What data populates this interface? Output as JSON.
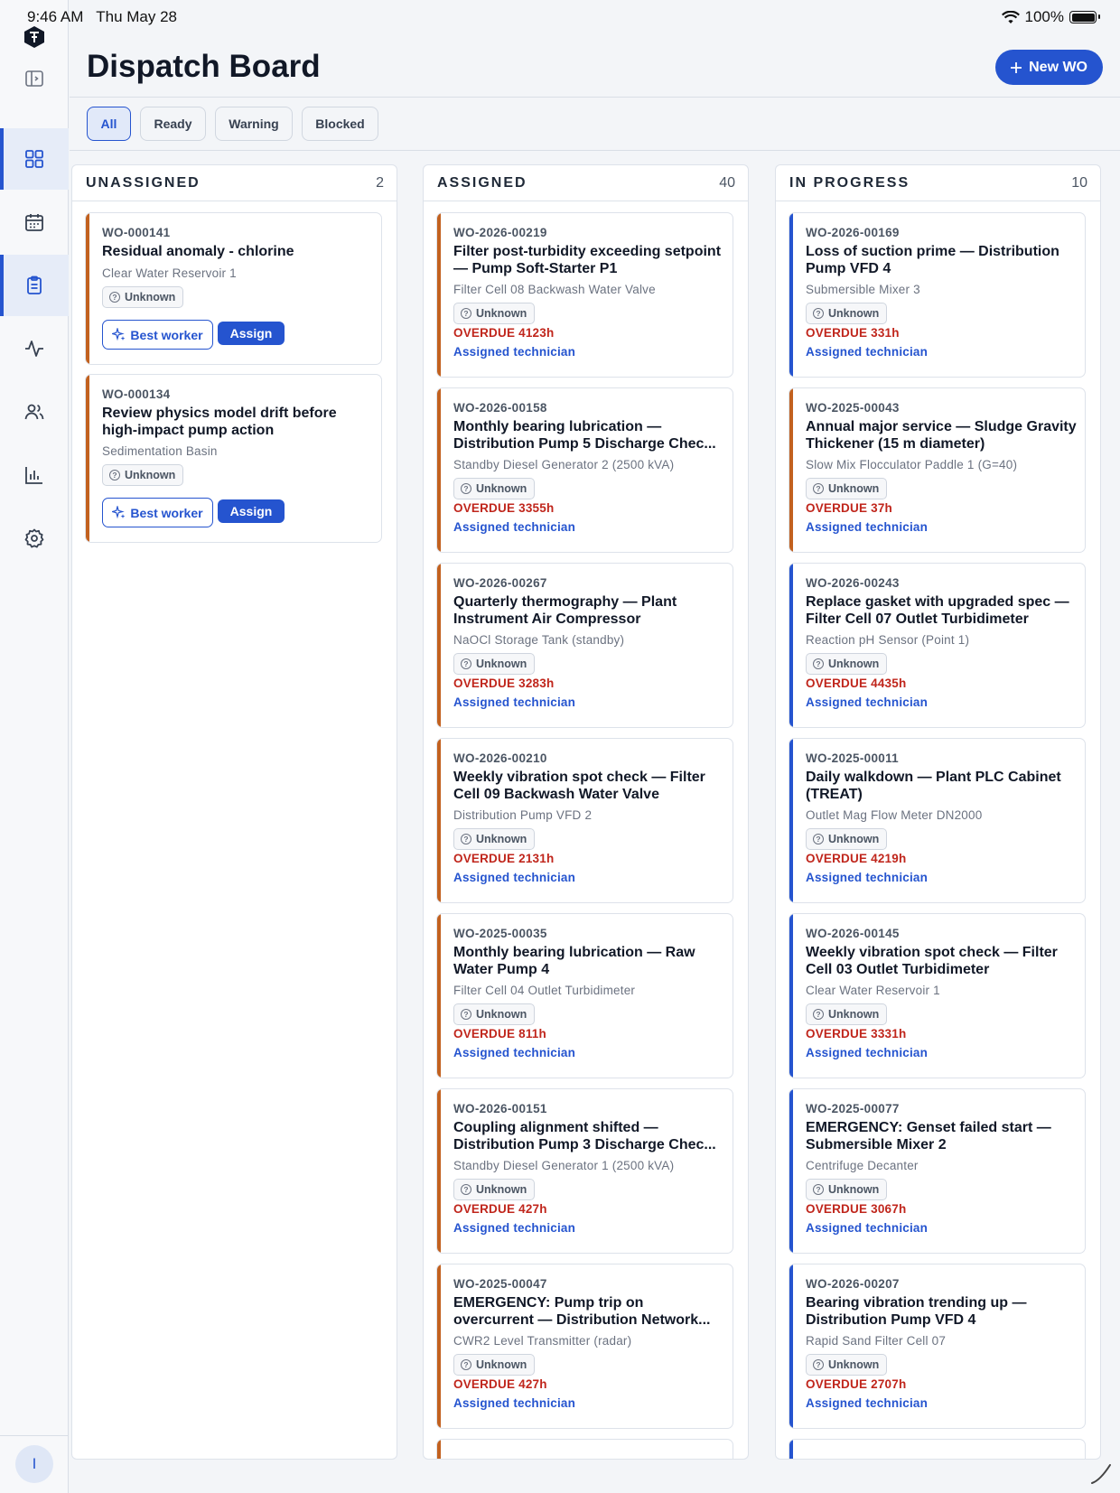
{
  "status_bar": {
    "time": "9:46 AM",
    "date": "Thu May 28",
    "battery": "100%"
  },
  "header": {
    "title": "Dispatch Board",
    "new_button": "New WO"
  },
  "sidebar": {
    "user_initial": "I",
    "nav": [
      {
        "icon": "dashboard-grid-icon",
        "active": true
      },
      {
        "icon": "calendar-icon",
        "active": false
      },
      {
        "icon": "clipboard-icon",
        "active": true
      },
      {
        "icon": "activity-pulse-icon",
        "active": false
      },
      {
        "icon": "users-icon",
        "active": false
      },
      {
        "icon": "bar-chart-icon",
        "active": false
      },
      {
        "icon": "settings-gear-icon",
        "active": false
      }
    ]
  },
  "filters": [
    {
      "label": "All",
      "active": true
    },
    {
      "label": "Ready",
      "active": false
    },
    {
      "label": "Warning",
      "active": false
    },
    {
      "label": "Blocked",
      "active": false
    }
  ],
  "columns": [
    {
      "title": "UNASSIGNED",
      "count": "2",
      "cards": [
        {
          "id": "WO-000141",
          "title": "Residual anomaly - chlorine",
          "asset": "Clear Water Reservoir 1",
          "badge": "Unknown",
          "accent": "#c2611f",
          "best_worker": "Best worker",
          "assign": "Assign"
        },
        {
          "id": "WO-000134",
          "title": "Review physics model drift before high-impact pump action",
          "asset": "Sedimentation Basin",
          "badge": "Unknown",
          "accent": "#c2611f",
          "best_worker": "Best worker",
          "assign": "Assign"
        }
      ]
    },
    {
      "title": "ASSIGNED",
      "count": "40",
      "cards": [
        {
          "id": "WO-2026-00219",
          "title": "Filter post-turbidity exceeding setpoint — Pump Soft-Starter P1",
          "asset": "Filter Cell 08 Backwash Water Valve",
          "badge": "Unknown",
          "overdue": "OVERDUE 4123h",
          "tech": "Assigned technician",
          "accent": "#c2611f"
        },
        {
          "id": "WO-2026-00158",
          "title": "Monthly bearing lubrication — Distribution Pump 5 Discharge Chec...",
          "asset": "Standby Diesel Generator 2 (2500 kVA)",
          "badge": "Unknown",
          "overdue": "OVERDUE 3355h",
          "tech": "Assigned technician",
          "accent": "#c2611f"
        },
        {
          "id": "WO-2026-00267",
          "title": "Quarterly thermography — Plant Instrument Air Compressor",
          "asset": "NaOCl Storage Tank (standby)",
          "badge": "Unknown",
          "overdue": "OVERDUE 3283h",
          "tech": "Assigned technician",
          "accent": "#c2611f"
        },
        {
          "id": "WO-2026-00210",
          "title": "Weekly vibration spot check — Filter Cell 09 Backwash Water Valve",
          "asset": "Distribution Pump VFD 2",
          "badge": "Unknown",
          "overdue": "OVERDUE 2131h",
          "tech": "Assigned technician",
          "accent": "#c2611f"
        },
        {
          "id": "WO-2025-00035",
          "title": "Monthly bearing lubrication — Raw Water Pump 4",
          "asset": "Filter Cell 04 Outlet Turbidimeter",
          "badge": "Unknown",
          "overdue": "OVERDUE 811h",
          "tech": "Assigned technician",
          "accent": "#c2611f"
        },
        {
          "id": "WO-2026-00151",
          "title": "Coupling alignment shifted — Distribution Pump 3 Discharge Chec...",
          "asset": "Standby Diesel Generator 1 (2500 kVA)",
          "badge": "Unknown",
          "overdue": "OVERDUE 427h",
          "tech": "Assigned technician",
          "accent": "#c2611f"
        },
        {
          "id": "WO-2025-00047",
          "title": "EMERGENCY: Pump trip on overcurrent — Distribution Network...",
          "asset": "CWR2 Level Transmitter (radar)",
          "badge": "Unknown",
          "overdue": "OVERDUE 427h",
          "tech": "Assigned technician",
          "accent": "#c2611f"
        }
      ]
    },
    {
      "title": "IN PROGRESS",
      "count": "10",
      "cards": [
        {
          "id": "WO-2026-00169",
          "title": "Loss of suction prime — Distribution Pump VFD 4",
          "asset": "Submersible Mixer 3",
          "badge": "Unknown",
          "overdue": "OVERDUE 331h",
          "tech": "Assigned technician",
          "accent": "#2554cf"
        },
        {
          "id": "WO-2025-00043",
          "title": "Annual major service — Sludge Gravity Thickener (15 m diameter)",
          "asset": "Slow Mix Flocculator Paddle 1 (G=40)",
          "badge": "Unknown",
          "overdue": "OVERDUE 37h",
          "tech": "Assigned technician",
          "accent": "#c2611f"
        },
        {
          "id": "WO-2026-00243",
          "title": "Replace gasket with upgraded spec — Filter Cell 07 Outlet Turbidimeter",
          "asset": "Reaction pH Sensor (Point 1)",
          "badge": "Unknown",
          "overdue": "OVERDUE 4435h",
          "tech": "Assigned technician",
          "accent": "#2554cf"
        },
        {
          "id": "WO-2025-00011",
          "title": "Daily walkdown — Plant PLC Cabinet (TREAT)",
          "asset": "Outlet Mag Flow Meter DN2000",
          "badge": "Unknown",
          "overdue": "OVERDUE 4219h",
          "tech": "Assigned technician",
          "accent": "#2554cf"
        },
        {
          "id": "WO-2026-00145",
          "title": "Weekly vibration spot check — Filter Cell 03 Outlet Turbidimeter",
          "asset": "Clear Water Reservoir 1",
          "badge": "Unknown",
          "overdue": "OVERDUE 3331h",
          "tech": "Assigned technician",
          "accent": "#2554cf"
        },
        {
          "id": "WO-2025-00077",
          "title": "EMERGENCY: Genset failed start — Submersible Mixer 2",
          "asset": "Centrifuge Decanter",
          "badge": "Unknown",
          "overdue": "OVERDUE 3067h",
          "tech": "Assigned technician",
          "accent": "#2554cf"
        },
        {
          "id": "WO-2026-00207",
          "title": "Bearing vibration trending up — Distribution Pump VFD 4",
          "asset": "Rapid Sand Filter Cell 07",
          "badge": "Unknown",
          "overdue": "OVERDUE 2707h",
          "tech": "Assigned technician",
          "accent": "#2554cf"
        }
      ]
    }
  ]
}
